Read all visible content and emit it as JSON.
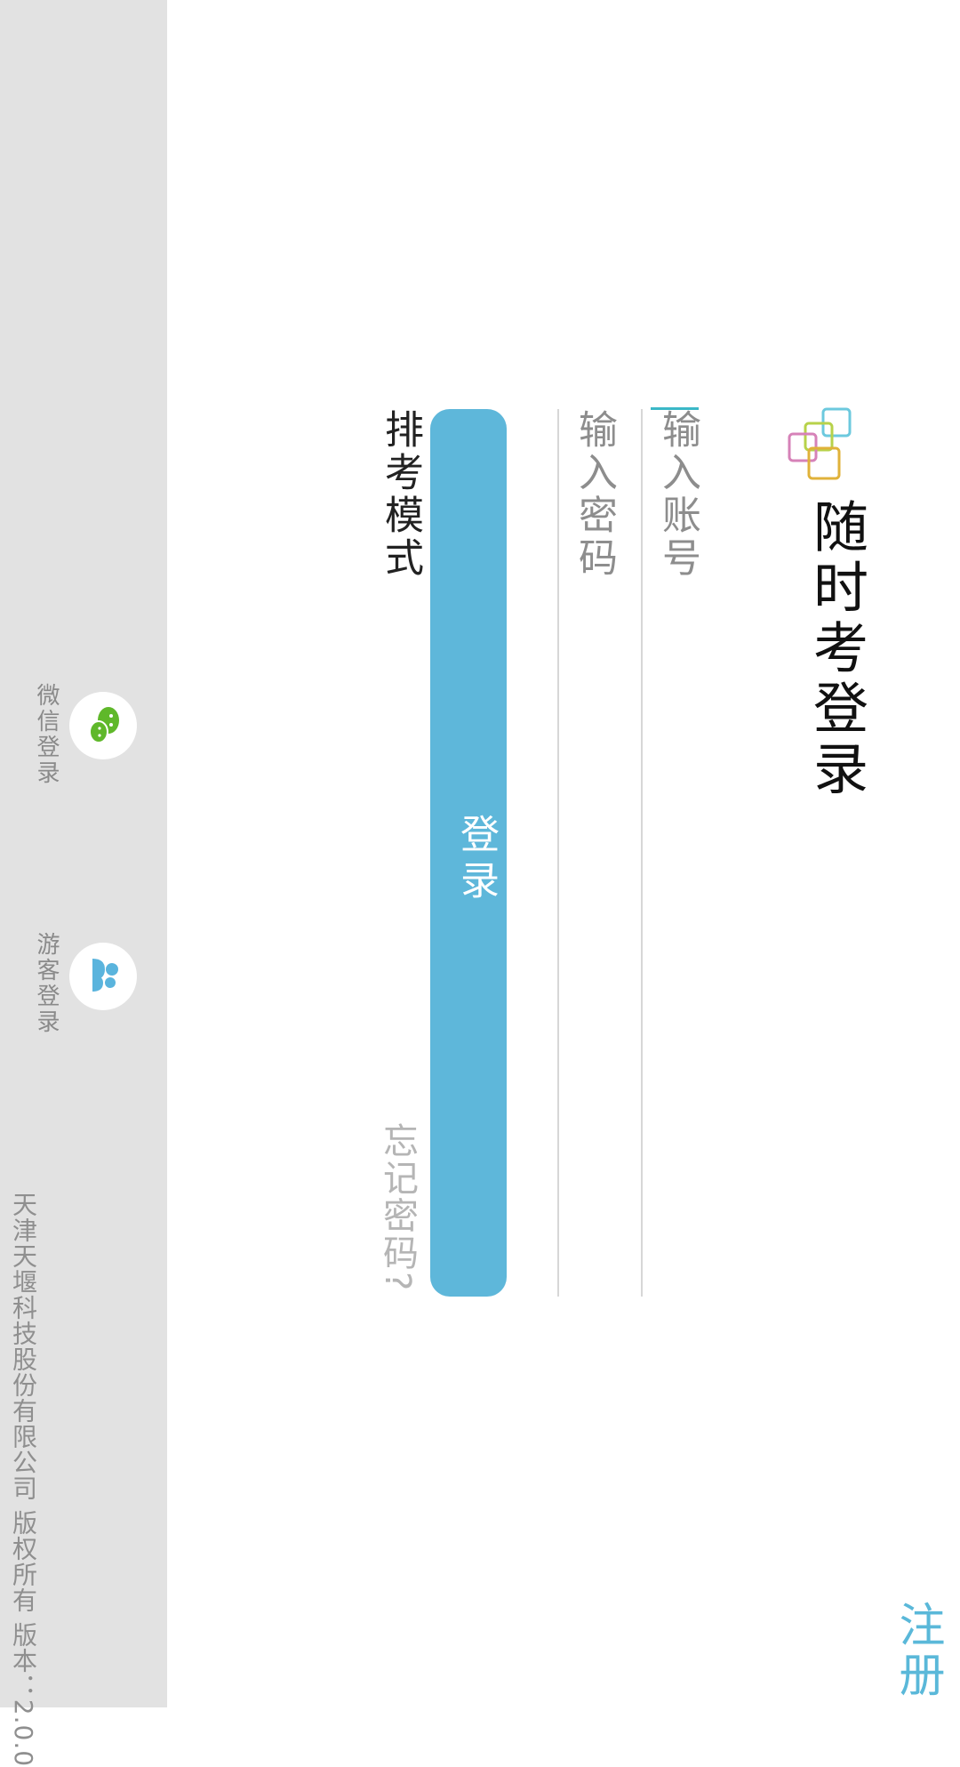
{
  "header": {
    "register_label": "注册",
    "title": "随时考登录"
  },
  "form": {
    "account_placeholder": "输入账号",
    "password_placeholder": "输入密码",
    "login_label": "登录",
    "mock_exam_label": "排考模式",
    "forgot_password_label": "忘记密码?"
  },
  "social": {
    "wechat_label": "微信登录",
    "guest_label": "游客登录"
  },
  "footer": {
    "copyright": "天津天堰科技股份有限公司 版权所有  版本：2.0.0"
  },
  "icons": {
    "logo": "overlapping-squares-logo-icon",
    "wechat": "wechat-icon",
    "guest": "guest-users-icon"
  },
  "colors": {
    "accent": "#5eb7da",
    "footer_bg": "#e2e2e2",
    "wechat_green": "#5fb82a",
    "caret": "#3bb8c7"
  }
}
